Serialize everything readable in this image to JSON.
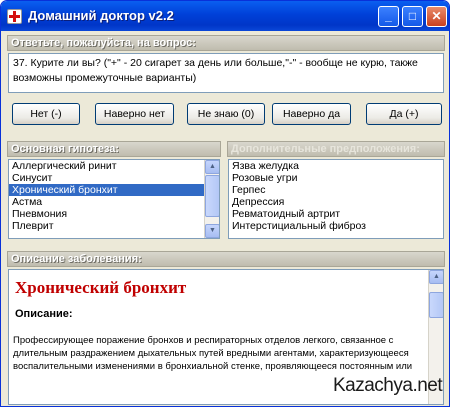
{
  "window": {
    "title": "Домашний доктор v2.2",
    "controls": {
      "minimize": "_",
      "maximize": "□",
      "close": "✕"
    }
  },
  "question": {
    "header": "Ответьте, пожалуйста, на вопрос:",
    "text": "37. Курите ли вы? (\"+\" - 20 сигарет за день или больше,\"-\" - вообще не курю, также возможны промежуточные варианты)"
  },
  "answers": [
    "Нет (-)",
    "Наверно нет",
    "Не знаю (0)",
    "Наверно да",
    "Да (+)"
  ],
  "main_hypothesis": {
    "header": "Основная гипотеза:",
    "items": [
      "Аллергический ринит",
      "Синусит",
      "Хронический бронхит",
      "Астма",
      "Пневмония",
      "Плеврит"
    ],
    "selected": "Хронический бронхит"
  },
  "additional": {
    "header": "Дополнительные предположения:",
    "items": [
      "Язва желудка",
      "Розовые угри",
      "Герпес",
      "Депрессия",
      "Ревматоидный артрит",
      "Интерстициальный фиброз"
    ]
  },
  "description": {
    "header": "Описание заболевания:",
    "title": "Хронический бронхит",
    "label": "Описание:",
    "body": "Профессирующее поражение бронхов и респираторных отделов легкого, связанное с длительным раздражением дыхательных путей вредными агентами, характеризующееся воспалительными изменениями в бронхиальной стенке, проявляющееся постоянным или"
  },
  "watermark": "Kazachya.net",
  "colors": {
    "title_bar": "#0040d8",
    "selection": "#316ac5",
    "disease_title": "#c00000"
  }
}
